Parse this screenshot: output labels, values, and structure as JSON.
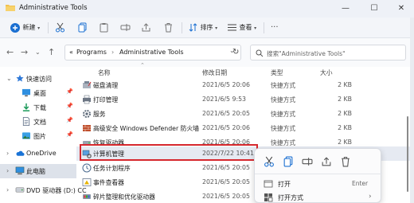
{
  "window": {
    "title": "Administrative Tools"
  },
  "toolbar": {
    "new_label": "新建",
    "sort_label": "排序",
    "view_label": "查看"
  },
  "address": {
    "root_glyph": "«",
    "crumbs": [
      "Programs",
      "Administrative Tools"
    ],
    "separator": "›"
  },
  "search": {
    "placeholder": "搜索\"Administrative Tools\""
  },
  "sidebar": {
    "items": [
      {
        "label": "快速访问",
        "icon": "star-icon"
      },
      {
        "label": "桌面",
        "icon": "desktop-icon"
      },
      {
        "label": "下载",
        "icon": "download-icon"
      },
      {
        "label": "文档",
        "icon": "document-icon"
      },
      {
        "label": "图片",
        "icon": "picture-icon"
      },
      {
        "label": "OneDrive",
        "icon": "cloud-icon"
      },
      {
        "label": "此电脑",
        "icon": "computer-icon"
      },
      {
        "label": "DVD 驱动器 (D:) CC",
        "icon": "dvd-icon"
      }
    ]
  },
  "columns": {
    "name": "名称",
    "date": "修改日期",
    "type": "类型",
    "size": "大小"
  },
  "files": [
    {
      "name": "磁盘清理",
      "date": "2021/6/5 20:06",
      "type": "快捷方式",
      "size": "2 KB"
    },
    {
      "name": "打印管理",
      "date": "2021/6/5 9:53",
      "type": "快捷方式",
      "size": "2 KB"
    },
    {
      "name": "服务",
      "date": "2021/6/5 20:05",
      "type": "快捷方式",
      "size": "2 KB"
    },
    {
      "name": "高级安全 Windows Defender 防火墙",
      "date": "2021/6/5 20:06",
      "type": "快捷方式",
      "size": "2 KB"
    },
    {
      "name": "恢复驱动器",
      "date": "2021/6/5 20:06",
      "type": "快捷方式",
      "size": "2 KB"
    },
    {
      "name": "计算机管理",
      "date": "2022/7/22 10:41",
      "type": "",
      "size": ""
    },
    {
      "name": "任务计划程序",
      "date": "2021/6/5 20:05",
      "type": "",
      "size": ""
    },
    {
      "name": "事件查看器",
      "date": "2021/6/5 20:05",
      "type": "",
      "size": ""
    },
    {
      "name": "碎片整理和优化驱动器",
      "date": "2021/6/5 20:05",
      "type": "",
      "size": ""
    }
  ],
  "context_menu": {
    "items": [
      {
        "label": "打开",
        "hint": "Enter"
      },
      {
        "label": "打开方式",
        "hint": ""
      }
    ]
  },
  "colors": {
    "highlight_border": "#d6282e",
    "folder": "#f2c14e",
    "accent": "#0a64c2"
  }
}
